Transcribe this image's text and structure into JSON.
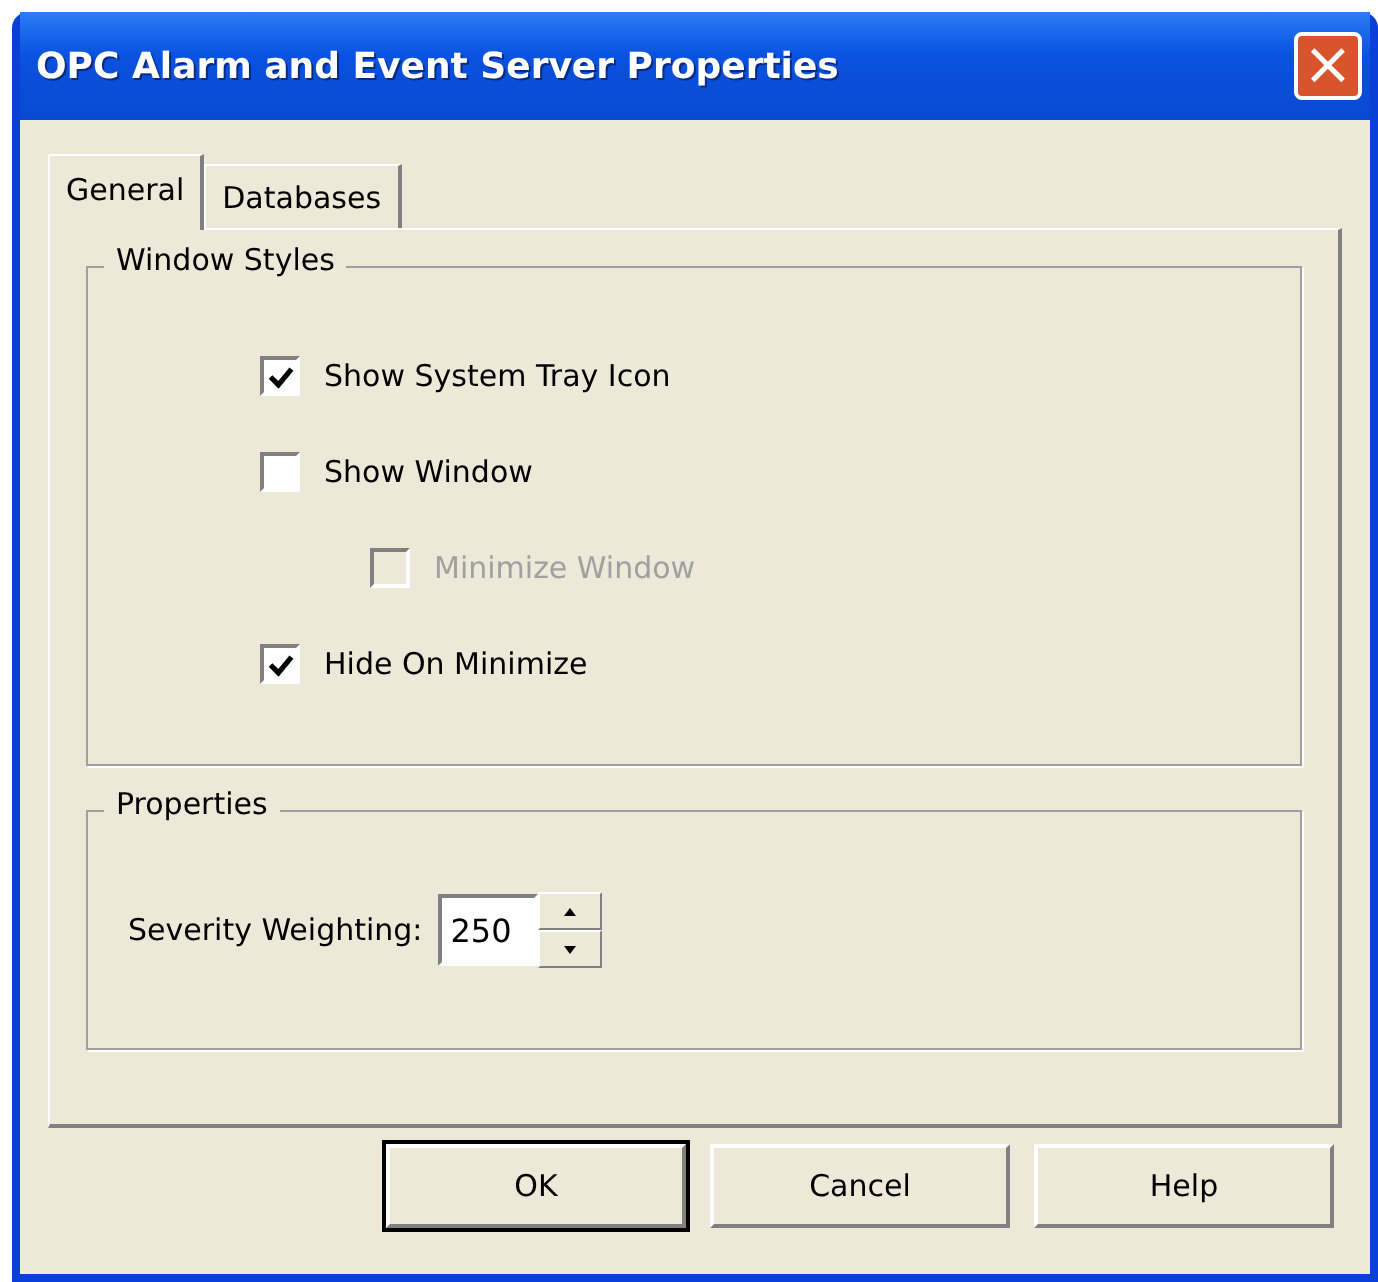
{
  "window": {
    "title": "OPC Alarm and Event Server Properties",
    "close": "×"
  },
  "tabs": [
    {
      "label": "General",
      "selected": true
    },
    {
      "label": "Databases",
      "selected": false
    }
  ],
  "window_styles": {
    "title": "Window Styles",
    "options": [
      {
        "label": "Show System Tray Icon",
        "checked": true,
        "disabled": false
      },
      {
        "label": "Show Window",
        "checked": false,
        "disabled": false,
        "children": [
          {
            "label": "Minimize Window",
            "checked": false,
            "disabled": true
          }
        ]
      },
      {
        "label": "Hide On Minimize",
        "checked": true,
        "disabled": false
      }
    ]
  },
  "properties": {
    "title": "Properties",
    "severity_label": "Severity Weighting:",
    "severity_value": "250"
  },
  "buttons": [
    {
      "label": "OK",
      "default": true
    },
    {
      "label": "Cancel",
      "default": false
    },
    {
      "label": "Help",
      "default": false
    }
  ]
}
